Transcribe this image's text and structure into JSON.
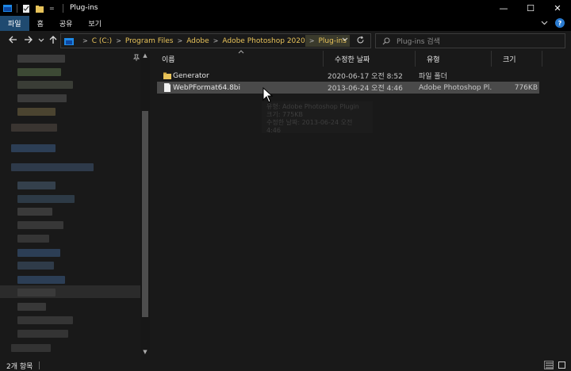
{
  "window": {
    "title": "Plug-ins",
    "minimize_glyph": "—",
    "maximize_glyph": "☐",
    "close_glyph": "✕"
  },
  "ribbon": {
    "tabs": [
      {
        "label": "파일",
        "active": true
      },
      {
        "label": "홈",
        "active": false
      },
      {
        "label": "공유",
        "active": false
      },
      {
        "label": "보기",
        "active": false
      }
    ]
  },
  "address": {
    "crumbs": [
      "C (C:)",
      "Program Files",
      "Adobe",
      "Adobe Photoshop 2020",
      "Plug-ins"
    ]
  },
  "search": {
    "placeholder": "Plug-ins 검색"
  },
  "columns": {
    "name": "이름",
    "date": "수정한 날짜",
    "type": "유형",
    "size": "크기"
  },
  "files": [
    {
      "name": "Generator",
      "date": "2020-06-17 오전 8:52",
      "type": "파일 폴더",
      "size": "",
      "kind": "folder"
    },
    {
      "name": "WebPFormat64.8bi",
      "date": "2013-06-24 오전 4:46",
      "type": "Adobe Photoshop Pl...",
      "size": "776KB",
      "kind": "file"
    }
  ],
  "tooltip": {
    "line1": "유형: Adobe Photoshop Plugin",
    "line2": "크기: 775KB",
    "line3": "수정한 날짜: 2013-06-24 오전 4:46"
  },
  "status": {
    "item_count": "2개 항목"
  },
  "colors": {
    "accent_tab": "#1f4a70",
    "folder": "#e8c35a",
    "breadcrumb": "#e8c35a"
  }
}
